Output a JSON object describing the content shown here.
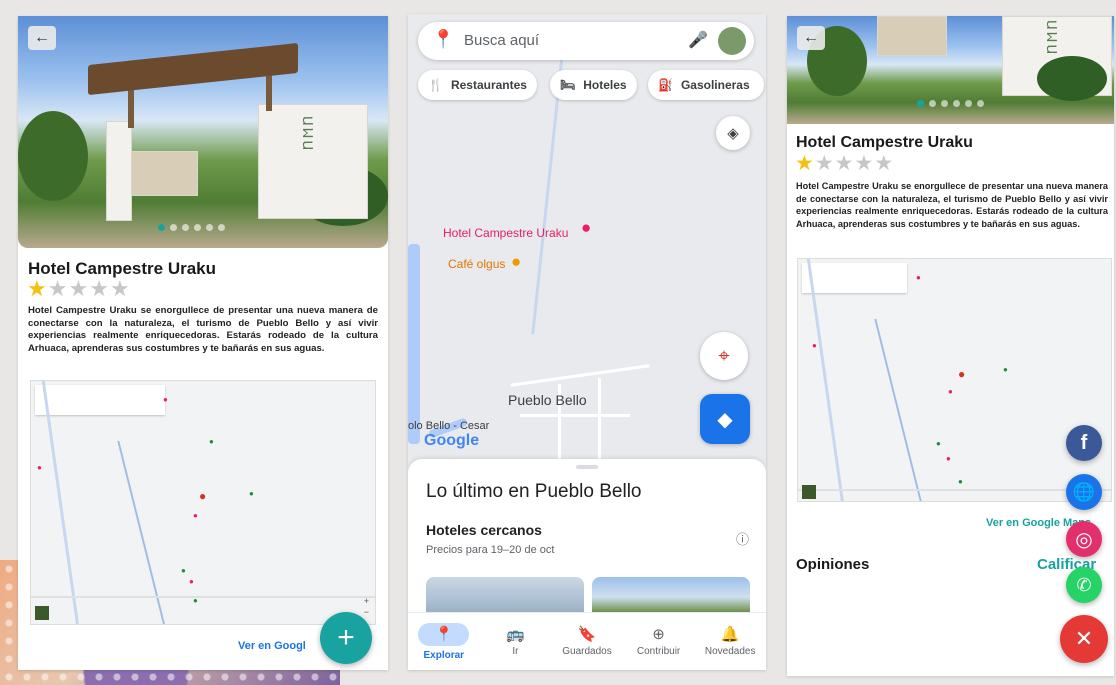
{
  "colors": {
    "accent_teal": "#18a3a0",
    "star": "#f4c20d",
    "maps_blue": "#1a73e8",
    "facebook": "#3b5998",
    "instagram": "#e1306c",
    "whatsapp": "#25d366",
    "close_red": "#e53935"
  },
  "hotel": {
    "name": "Hotel Campestre Uraku",
    "rating": 1,
    "max_rating": 5,
    "description": "Hotel Campestre Uraku se enorgullece de presentar una nueva manera de conectarse con la naturaleza, el turismo de Pueblo Bello y así vivir experiencias realmente enriquecedoras. Estarás rodeado de la cultura Arhuaca, aprenderas sus costumbres y te bañarás en sus aguas.",
    "carousel_total": 6,
    "carousel_active": 1,
    "map_link": "Ver en Google Maps",
    "map_link_cut": "Ver en Googl"
  },
  "fab_add_icon": "+",
  "maps": {
    "search_placeholder": "Busca aquí",
    "chips": [
      {
        "icon": "fork-knife-icon",
        "glyph": "🍴",
        "label": "Restaurantes"
      },
      {
        "icon": "bed-icon",
        "glyph": "🛏",
        "label": "Hoteles"
      },
      {
        "icon": "gas-pump-icon",
        "glyph": "⛽",
        "label": "Gasolineras"
      }
    ],
    "map_labels": {
      "hotel": "Hotel Campestre Uraku",
      "cafe": "Café olgus",
      "town": "Pueblo Bello",
      "town_cesar": "olo Bello - Cesar",
      "google": "Google"
    },
    "sheet": {
      "heading": "Lo último en Pueblo Bello",
      "section_title": "Hoteles cercanos",
      "section_subtitle": "Precios para 19–20 de oct"
    },
    "nav": [
      {
        "icon": "pin-icon",
        "glyph": "📍",
        "label": "Explorar",
        "active": true
      },
      {
        "icon": "commute-icon",
        "glyph": "🚌",
        "label": "Ir",
        "active": false
      },
      {
        "icon": "bookmark-icon",
        "glyph": "🔖",
        "label": "Guardados",
        "active": false
      },
      {
        "icon": "add-circle-icon",
        "glyph": "⊕",
        "label": "Contribuir",
        "active": false
      },
      {
        "icon": "bell-icon",
        "glyph": "🔔",
        "label": "Novedades",
        "active": false
      }
    ]
  },
  "detail": {
    "opinions_label": "Opiniones",
    "rate_label": "Calificar",
    "map_link": "Ver en Google Maps",
    "social": [
      {
        "name": "facebook-button",
        "glyph": "f"
      },
      {
        "name": "website-button",
        "glyph": "🌐"
      },
      {
        "name": "instagram-button",
        "glyph": "◎"
      },
      {
        "name": "whatsapp-button",
        "glyph": "✆"
      },
      {
        "name": "close-button",
        "glyph": "✕"
      }
    ]
  }
}
